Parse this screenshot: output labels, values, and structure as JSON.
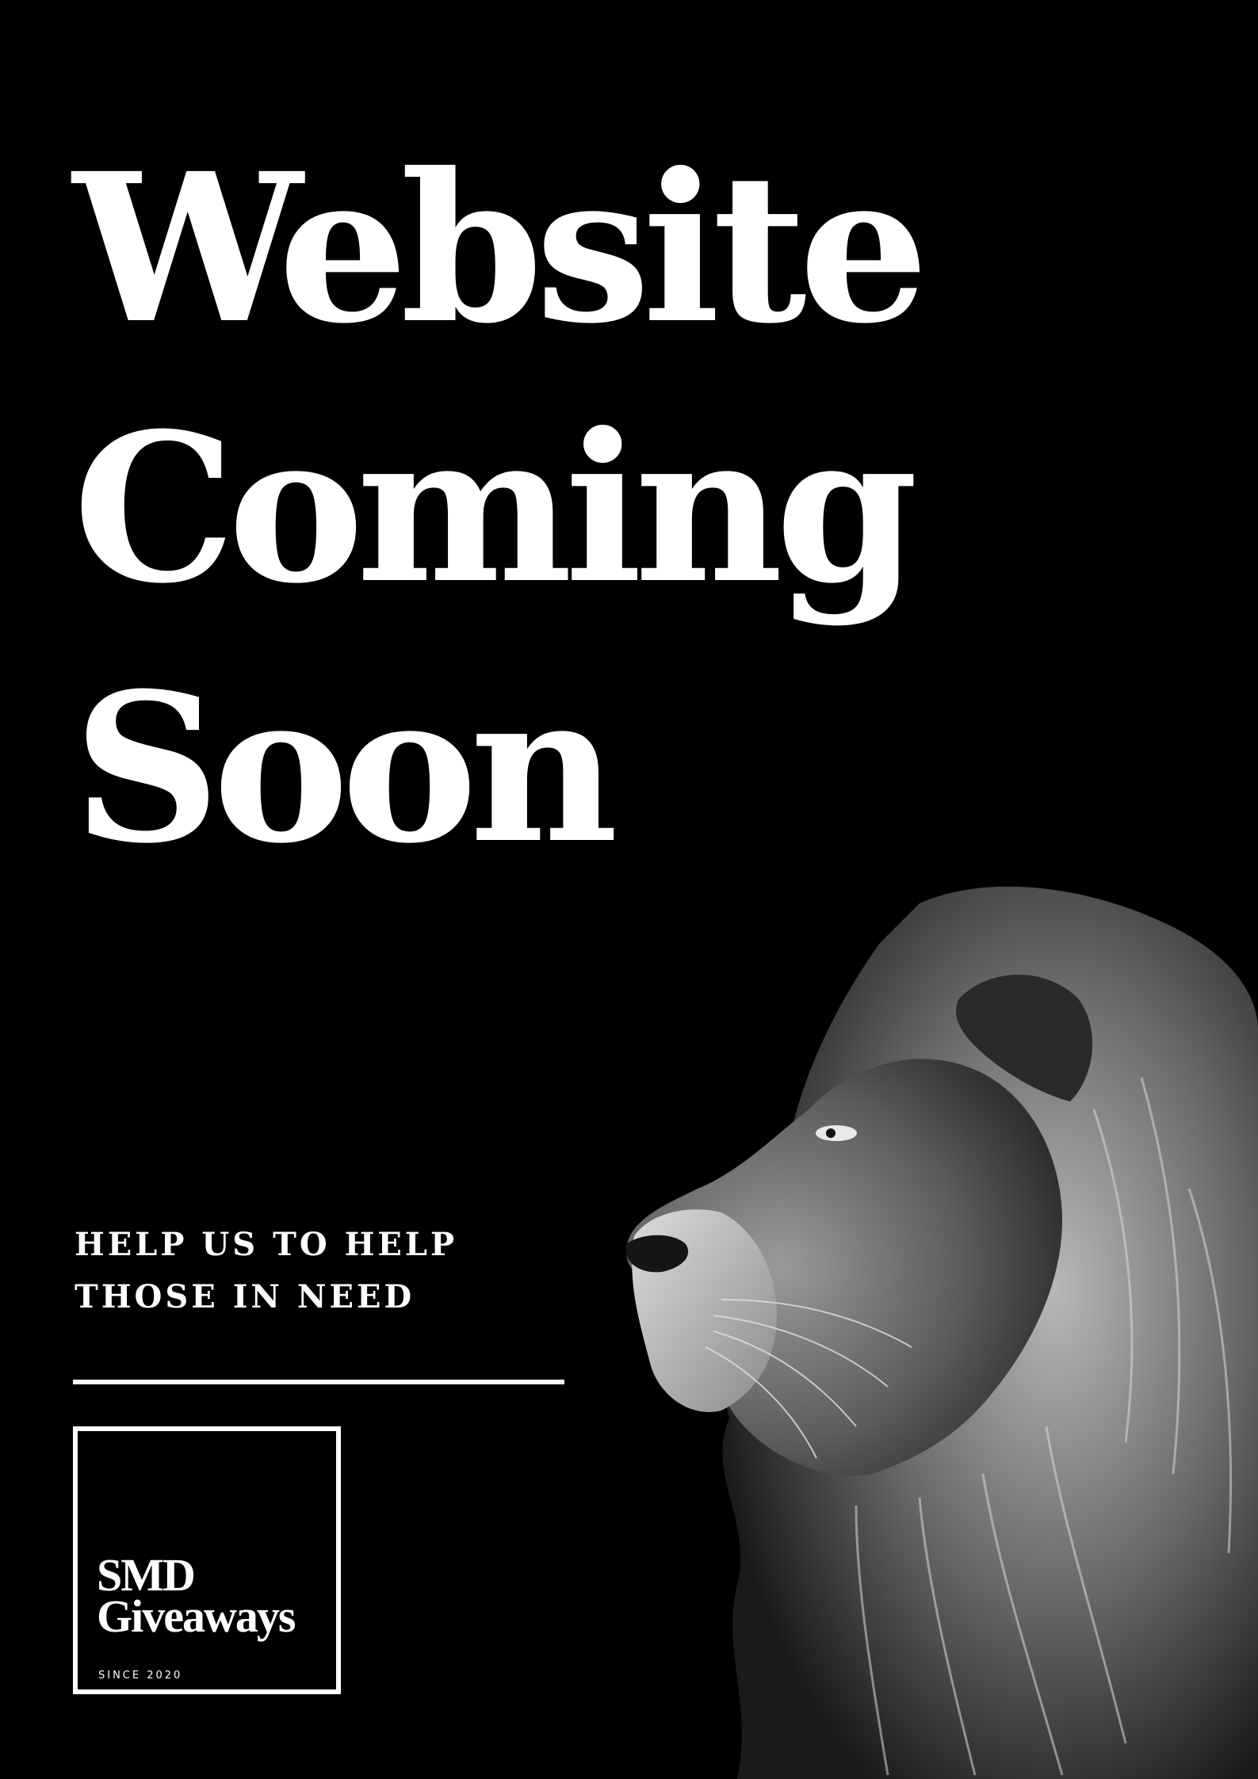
{
  "headline": {
    "line1": "Website",
    "line2": "Coming",
    "line3": "Soon"
  },
  "tagline": {
    "line1": "HELP US TO HELP",
    "line2": "THOSE IN NEED"
  },
  "logo": {
    "name_line1": "SMD",
    "name_line2": "Giveaways",
    "since": "SINCE 2020"
  },
  "colors": {
    "background": "#000000",
    "text": "#ffffff"
  },
  "image": {
    "subject": "lion-profile-photo"
  }
}
